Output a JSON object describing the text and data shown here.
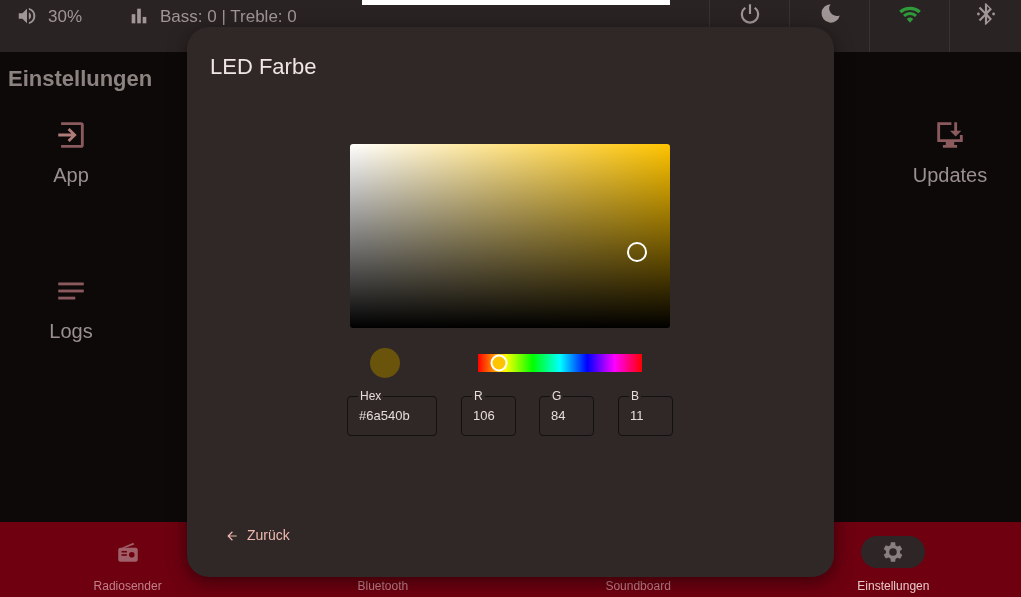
{
  "status_bar": {
    "volume": "30%",
    "equalizer": "Bass: 0 | Treble: 0",
    "wifi_connected": true
  },
  "page": {
    "title": "Einstellungen",
    "left_items": [
      {
        "label": "App"
      },
      {
        "label": "Logs"
      }
    ],
    "right_items": [
      {
        "label": "Updates"
      }
    ]
  },
  "dialog": {
    "title": "LED Farbe",
    "picker": {
      "color": "#6a540b"
    },
    "fields": [
      {
        "label": "Hex",
        "value": "#6a540b"
      },
      {
        "label": "R",
        "value": "106"
      },
      {
        "label": "G",
        "value": "84"
      },
      {
        "label": "B",
        "value": "11"
      }
    ],
    "back_button": "Zurück"
  },
  "bottom_nav": [
    {
      "label": "Radiosender",
      "selected": false
    },
    {
      "label": "Bluetooth",
      "selected": false
    },
    {
      "label": "Soundboard",
      "selected": false
    },
    {
      "label": "Einstellungen",
      "selected": true
    }
  ]
}
